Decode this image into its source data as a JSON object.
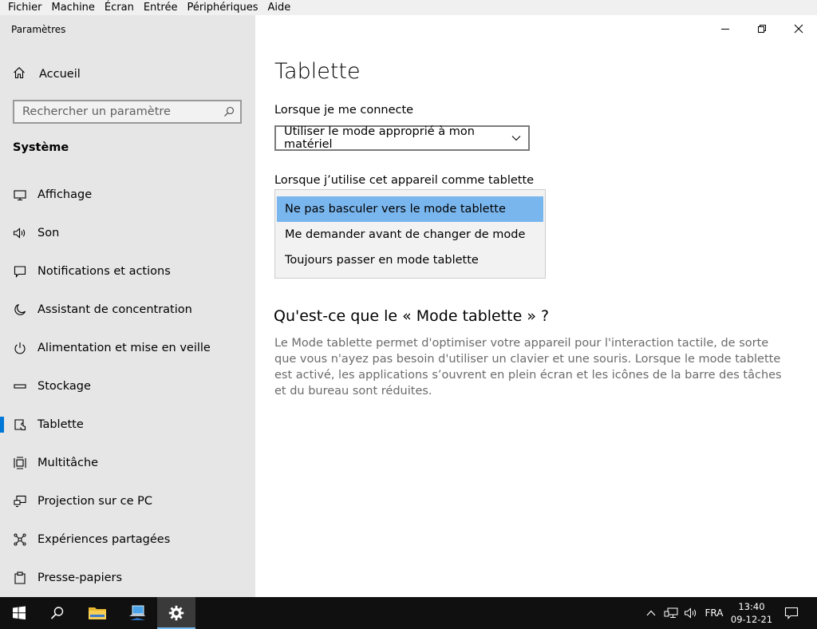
{
  "menubar": [
    "Fichier",
    "Machine",
    "Écran",
    "Entrée",
    "Périphériques",
    "Aide"
  ],
  "app": {
    "title": "Paramètres"
  },
  "sidebar": {
    "home_label": "Accueil",
    "search_placeholder": "Rechercher un paramètre",
    "section_title": "Système",
    "items": [
      {
        "label": "Affichage",
        "icon": "monitor-icon"
      },
      {
        "label": "Son",
        "icon": "speaker-icon"
      },
      {
        "label": "Notifications et actions",
        "icon": "notification-icon"
      },
      {
        "label": "Assistant de concentration",
        "icon": "moon-icon"
      },
      {
        "label": "Alimentation et mise en veille",
        "icon": "power-icon"
      },
      {
        "label": "Stockage",
        "icon": "storage-icon"
      },
      {
        "label": "Tablette",
        "icon": "tablet-icon",
        "active": true
      },
      {
        "label": "Multitâche",
        "icon": "multitask-icon"
      },
      {
        "label": "Projection sur ce PC",
        "icon": "projection-icon"
      },
      {
        "label": "Expériences partagées",
        "icon": "shared-icon"
      },
      {
        "label": "Presse-papiers",
        "icon": "clipboard-icon"
      }
    ]
  },
  "main": {
    "title": "Tablette",
    "signin_label": "Lorsque je me connecte",
    "signin_value": "Utiliser le mode approprié à mon matériel",
    "tablet_label": "Lorsque j’utilise cet appareil comme tablette",
    "tablet_options": [
      "Ne pas basculer vers le mode tablette",
      "Me demander avant de changer de mode",
      "Toujours passer en mode tablette"
    ],
    "tablet_selected": 0,
    "info_title": "Qu'est-ce que le « Mode tablette » ?",
    "info_body": "Le Mode tablette permet d'optimiser votre appareil pour l'interaction tactile, de sorte que vous n'ayez pas besoin d'utiliser un clavier et une souris. Lorsque le mode tablette est activé, les applications s’ouvrent en plein écran et les icônes de la barre des tâches et du bureau sont réduites."
  },
  "taskbar": {
    "language": "FRA",
    "time": "13:40",
    "date": "09-12-21"
  },
  "colors": {
    "accent": "#0078d7",
    "selection": "#7ab6ee",
    "taskbar": "#101010"
  }
}
